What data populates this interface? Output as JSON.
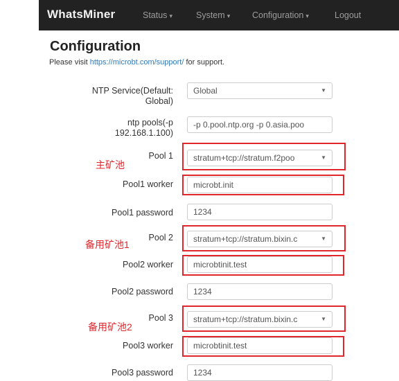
{
  "nav": {
    "brand": "WhatsMiner",
    "items": [
      "Status",
      "System",
      "Configuration",
      "Logout"
    ],
    "caret": "▾"
  },
  "page": {
    "title": "Configuration",
    "support_prefix": "Please visit ",
    "support_link": "https://microbt.com/support/",
    "support_suffix": " for support."
  },
  "form": {
    "ntp_service": {
      "label_line1": "NTP Service(Default:",
      "label_line2": "Global)",
      "value": "Global"
    },
    "ntp_pools": {
      "label_line1": "ntp pools(-p",
      "label_line2": "192.168.1.100)",
      "value": "-p 0.pool.ntp.org -p 0.asia.poo"
    },
    "pool1": {
      "label": "Pool 1",
      "value": "stratum+tcp://stratum.f2poo"
    },
    "pool1_worker": {
      "label": "Pool1 worker",
      "value": "microbt.init"
    },
    "pool1_password": {
      "label": "Pool1 password",
      "value": "1234"
    },
    "pool2": {
      "label": "Pool 2",
      "value": "stratum+tcp://stratum.bixin.c"
    },
    "pool2_worker": {
      "label": "Pool2 worker",
      "value": "microbtinit.test"
    },
    "pool2_password": {
      "label": "Pool2 password",
      "value": "1234"
    },
    "pool3": {
      "label": "Pool 3",
      "value": "stratum+tcp://stratum.bixin.c"
    },
    "pool3_worker": {
      "label": "Pool3 worker",
      "value": "microbtinit.test"
    },
    "pool3_password": {
      "label": "Pool3 password",
      "value": "1234"
    }
  },
  "annotations": {
    "primary_pool": "主矿池",
    "backup_pool_1": "备用矿池1",
    "backup_pool_2": "备用矿池2",
    "highlight_color": "#e0262b"
  },
  "icons": {
    "select_arrow": "▼"
  }
}
